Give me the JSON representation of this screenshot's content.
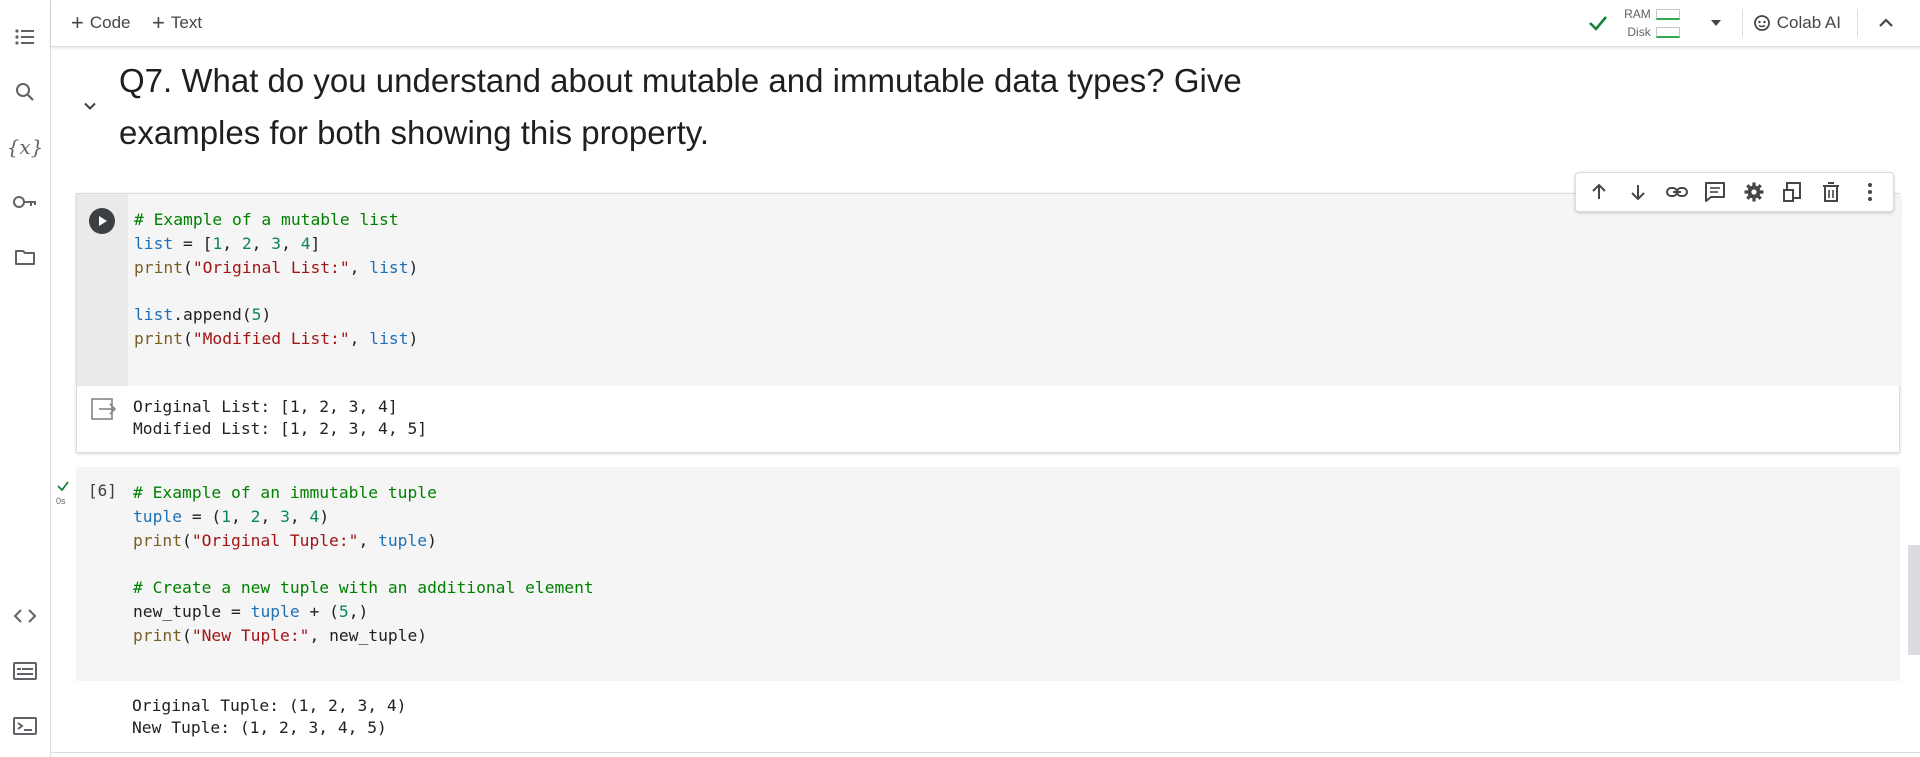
{
  "toolbar": {
    "add_code": "Code",
    "add_text": "Text",
    "ram_label": "RAM",
    "disk_label": "Disk",
    "colab_ai": "Colab AI"
  },
  "sidebar_icons": [
    "table-of-contents-icon",
    "search-icon",
    "variables-icon",
    "secrets-key-icon",
    "files-folder-icon",
    "code-snippets-icon",
    "command-palette-icon",
    "terminal-icon"
  ],
  "section": {
    "heading_line1": "Q7. What do you understand about mutable and immutable data types? Give",
    "heading_line2": "examples for both showing this property."
  },
  "cell1": {
    "code_lines": [
      "# Example of a mutable list",
      "list = [1, 2, 3, 4]",
      "print(\"Original List:\", list)",
      "",
      "list.append(5)",
      "print(\"Modified List:\", list)"
    ],
    "output_lines": [
      "Original List: [1, 2, 3, 4]",
      "Modified List: [1, 2, 3, 4, 5]"
    ]
  },
  "cell_toolbar": [
    "move-up-icon",
    "move-down-icon",
    "link-icon",
    "comment-icon",
    "settings-icon",
    "mirror-cell-icon",
    "delete-icon",
    "more-options-icon"
  ],
  "cell2": {
    "execution_count": "[6]",
    "exec_time": "0s",
    "code_lines": [
      "# Example of an immutable tuple",
      "tuple = (1, 2, 3, 4)",
      "print(\"Original Tuple:\", tuple)",
      "",
      "# Create a new tuple with an additional element",
      "new_tuple = tuple + (5,)",
      "print(\"New Tuple:\", new_tuple)"
    ],
    "output_lines": [
      "Original Tuple: (1, 2, 3, 4)",
      "New Tuple: (1, 2, 3, 4, 5)"
    ]
  },
  "colors": {
    "comment": "#008000",
    "variable": "#1f6fb5",
    "function": "#795e26",
    "string": "#a31515",
    "number": "#098658",
    "status_ok": "#188038"
  }
}
